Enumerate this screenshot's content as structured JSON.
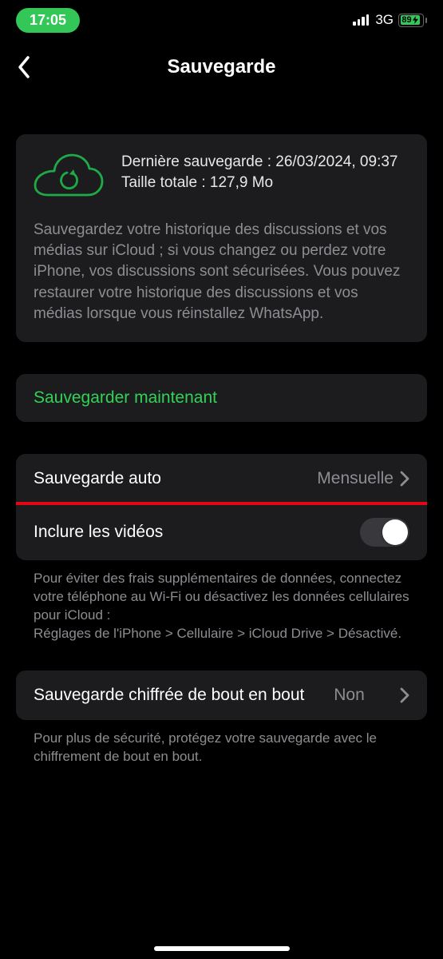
{
  "statusbar": {
    "time": "17:05",
    "network": "3G",
    "battery_pct": "89",
    "battery_width_pct": 89
  },
  "header": {
    "title": "Sauvegarde"
  },
  "info": {
    "last_backup_label": "Dernière sauvegarde : ",
    "last_backup_value": "26/03/2024, 09:37",
    "size_label": "Taille totale : ",
    "size_value": "127,9 Mo",
    "description": "Sauvegardez votre historique des discussions et vos médias sur iCloud ; si vous changez ou perdez votre iPhone, vos discussions sont sécurisées. Vous pouvez restaurer votre historique des discussions et vos médias lorsque vous réinstallez WhatsApp."
  },
  "actions": {
    "backup_now": "Sauvegarder maintenant"
  },
  "settings": {
    "auto_backup_label": "Sauvegarde auto",
    "auto_backup_value": "Mensuelle",
    "include_videos_label": "Inclure les vidéos",
    "include_videos_on": false,
    "data_note": "Pour éviter des frais supplémentaires de données, connectez votre téléphone au Wi-Fi ou désactivez les données cellulaires pour iCloud :\nRéglages de l'iPhone > Cellulaire > iCloud Drive > Désactivé.",
    "e2e_label": "Sauvegarde chiffrée de bout en bout",
    "e2e_value": "Non",
    "e2e_note": "Pour plus de sécurité, protégez votre sauvegarde avec le chiffrement de bout en bout."
  }
}
